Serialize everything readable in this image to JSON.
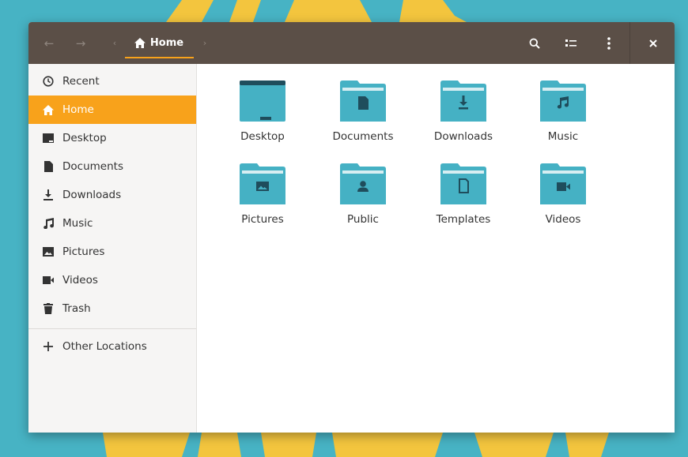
{
  "colors": {
    "accent": "#f8a21b",
    "headerbar": "#5b4f47",
    "folder": "#45b1c4",
    "folder_dark": "#1f4d5c",
    "wallpaper": "#47b3c4"
  },
  "header": {
    "back_icon": "arrow-left-icon",
    "forward_icon": "arrow-right-icon",
    "breadcrumb": {
      "current": "Home",
      "icon": "home-icon"
    },
    "search_icon": "search-icon",
    "view_icon": "list-view-icon",
    "menu_icon": "kebab-menu-icon",
    "close_icon": "close-icon"
  },
  "sidebar": {
    "items": [
      {
        "label": "Recent",
        "icon": "clock-icon"
      },
      {
        "label": "Home",
        "icon": "home-icon",
        "active": true
      },
      {
        "label": "Desktop",
        "icon": "desktop-icon"
      },
      {
        "label": "Documents",
        "icon": "document-icon"
      },
      {
        "label": "Downloads",
        "icon": "download-icon"
      },
      {
        "label": "Music",
        "icon": "music-icon"
      },
      {
        "label": "Pictures",
        "icon": "picture-icon"
      },
      {
        "label": "Videos",
        "icon": "video-icon"
      },
      {
        "label": "Trash",
        "icon": "trash-icon"
      }
    ],
    "other_locations": {
      "label": "Other Locations",
      "icon": "plus-icon"
    }
  },
  "folders": [
    {
      "name": "Desktop",
      "icon": "desktop-folder-icon"
    },
    {
      "name": "Documents",
      "icon": "documents-folder-icon"
    },
    {
      "name": "Downloads",
      "icon": "downloads-folder-icon"
    },
    {
      "name": "Music",
      "icon": "music-folder-icon"
    },
    {
      "name": "Pictures",
      "icon": "pictures-folder-icon"
    },
    {
      "name": "Public",
      "icon": "public-folder-icon"
    },
    {
      "name": "Templates",
      "icon": "templates-folder-icon"
    },
    {
      "name": "Videos",
      "icon": "videos-folder-icon"
    }
  ]
}
